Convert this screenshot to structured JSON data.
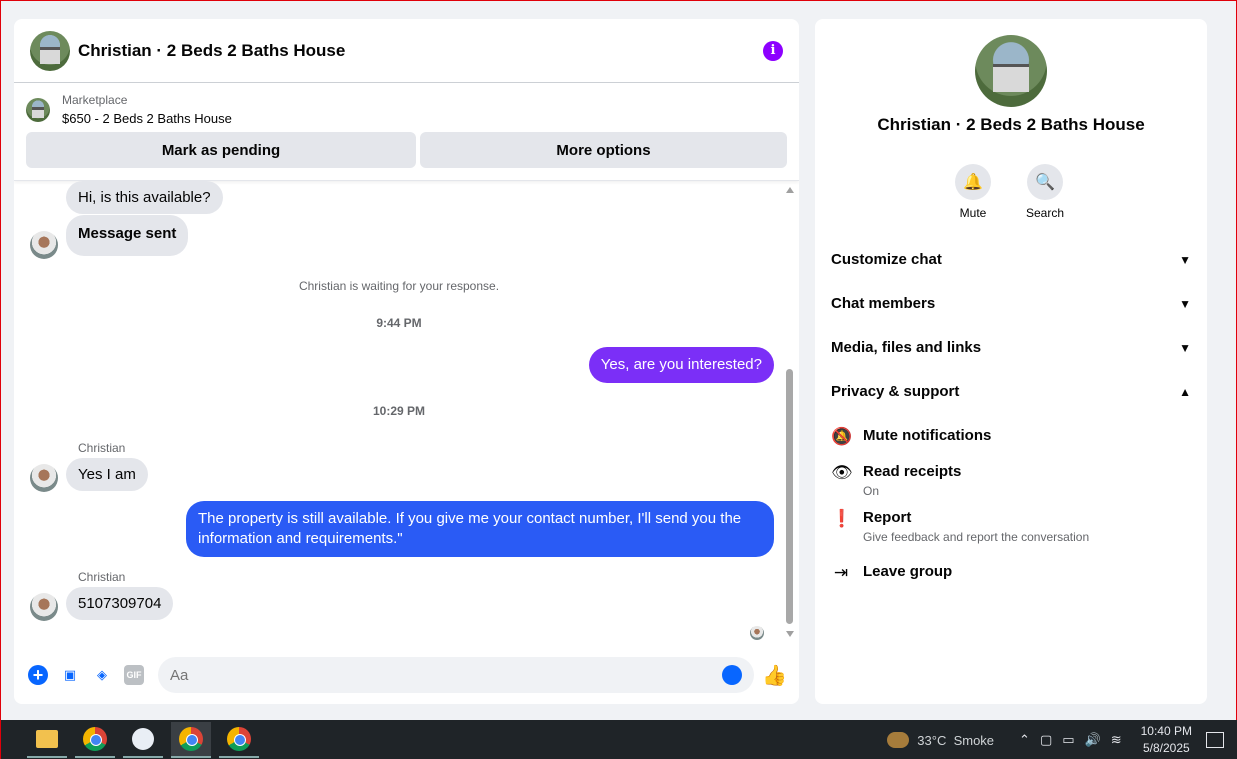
{
  "header": {
    "title": "Christian · 2 Beds 2 Baths House"
  },
  "marketplace": {
    "label": "Marketplace",
    "item": "$650 - 2 Beds 2 Baths House",
    "mark_pending": "Mark as pending",
    "more_options": "More options"
  },
  "messages": {
    "m1": "Hi, is this available?",
    "m2": "Message sent",
    "waiting": "Christian is waiting for your response.",
    "time1": "9:44 PM",
    "m3": "Yes, are you interested?",
    "time2": "10:29 PM",
    "sender1": "Christian",
    "m4": "Yes I am",
    "m5": "The property is still available. If you give me your contact number, I'll send you the information and requirements.\"",
    "sender2": "Christian",
    "m6": "5107309704"
  },
  "composer": {
    "placeholder": "Aa"
  },
  "side": {
    "name": "Christian · 2 Beds 2 Baths House",
    "mute": "Mute",
    "search": "Search",
    "sections": [
      "Customize chat",
      "Chat members",
      "Media, files and links",
      "Privacy & support"
    ],
    "options": {
      "mute_notifications": "Mute notifications",
      "read_receipts": "Read receipts",
      "read_receipts_value": "On",
      "report": "Report",
      "report_desc": "Give feedback and report the conversation",
      "leave_group": "Leave group"
    }
  },
  "taskbar": {
    "temperature": "33°C",
    "weather": "Smoke",
    "time": "10:40 PM",
    "date": "5/8/2025"
  },
  "colors": {
    "outgoing_purple": "#7b2ff7",
    "outgoing_blue": "#2a5bf5",
    "accent": "#0866ff"
  }
}
